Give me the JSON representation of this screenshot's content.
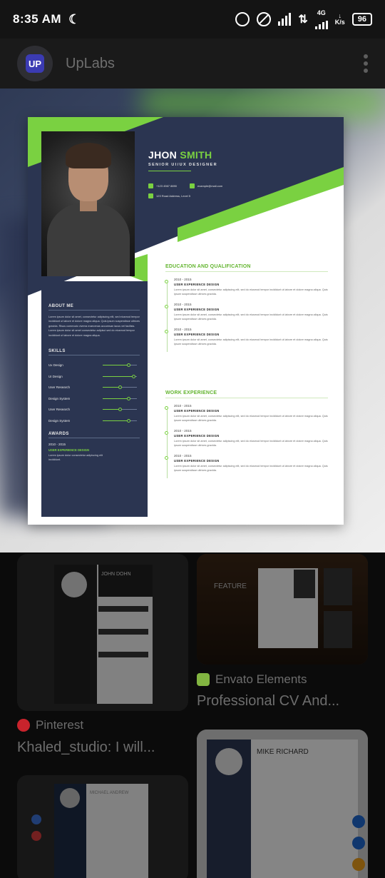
{
  "status_bar": {
    "time": "8:35 AM",
    "network": "4G",
    "speed_unit": "K/s",
    "battery": "96",
    "icons": [
      "moon-icon",
      "alarm-icon",
      "do-not-disturb-icon",
      "signal-icon",
      "data-arrows-icon",
      "signal-4g-icon",
      "battery-icon"
    ]
  },
  "app_bar": {
    "logo_text": "UP",
    "title": "UpLabs"
  },
  "resume": {
    "first_name": "JHON",
    "last_name": "SMITH",
    "role": "SENIOR UI/UX DESIGNER",
    "phone": "+123 4567 8890",
    "email": "example@mail.com",
    "address": "123 Road Address, Level 5",
    "about_title": "ABOUT ME",
    "about_text": "Lorem ipsum dolor sit amet, consectetur adipiscing elit, sed eiusmod tempor incididunt ut labore et dolore magna aliqua. Quis ipsum suspendisse ultrices gravida. Risus commodo viverra maecenas accumsan lacus vel facilisis. Lorem ipsum dolor sit amet consectetur adipisci sed do eiusmod tempor incididunt ut labore et dolore magna aliqua.",
    "skills_title": "SKILLS",
    "skills": [
      {
        "label": "Ux Design",
        "level": 0.75
      },
      {
        "label": "UI Design",
        "level": 0.9
      },
      {
        "label": "User Research",
        "level": 0.5
      },
      {
        "label": "Design System",
        "level": 0.75
      },
      {
        "label": "User Research",
        "level": 0.5
      },
      {
        "label": "Design System",
        "level": 0.75
      }
    ],
    "awards_title": "AWARDS",
    "award_years": "2010 - 2015",
    "award_name": "USER EXPERIENCE DESIGN",
    "award_text": "Lorem ipsum dolor consectetur adipiscing elit incididunt.",
    "education_title": "EDUCATION AND QUALIFICATION",
    "education": [
      {
        "years": "2010 - 2015",
        "title": "USER EXPERIENCE DESIGN",
        "desc": "Lorem ipsum dolor sit amet, consectetur adipiscing elit, sed do eiusmod tempor incididunt ut labore et dolore magna aliqua. Quis ipsum suspendisse ultrices gravida."
      },
      {
        "years": "2010 - 2015",
        "title": "USER EXPERIENCE DESIGN",
        "desc": "Lorem ipsum dolor sit amet, consectetur adipiscing elit, sed do eiusmod tempor incididunt ut labore et dolore magna aliqua. Quis ipsum suspendisse ultrices gravida."
      },
      {
        "years": "2010 - 2015",
        "title": "USER EXPERIENCE DESIGN",
        "desc": "Lorem ipsum dolor sit amet, consectetur adipiscing elit, sed do eiusmod tempor incididunt ut labore et dolore magna aliqua. Quis ipsum suspendisse ultrices gravida."
      }
    ],
    "work_title": "WORK EXPERIENCE",
    "work": [
      {
        "years": "2010 - 2015",
        "title": "USER EXPERIENCE DESIGN",
        "desc": "Lorem ipsum dolor sit amet, consectetur adipiscing elit, sed do eiusmod tempor incididunt ut labore et dolore magna aliqua. Quis ipsum suspendisse ultrices gravida."
      },
      {
        "years": "2010 - 2015",
        "title": "USER EXPERIENCE DESIGN",
        "desc": "Lorem ipsum dolor sit amet, consectetur adipiscing elit, sed do eiusmod tempor incididunt ut labore et dolore magna aliqua. Quis ipsum suspendisse ultrices gravida."
      },
      {
        "years": "2010 - 2015",
        "title": "USER EXPERIENCE DESIGN",
        "desc": "Lorem ipsum dolor sit amet, consectetur adipiscing elit, sed do eiusmod tempor incididunt ut labore et dolore magna aliqua. Quis ipsum suspendisse ultrices gravida."
      }
    ]
  },
  "results": [
    {
      "source": "Pinterest",
      "caption": "Khaled_studio: I will...",
      "thumb_title": "JOHN DOHN"
    },
    {
      "source": "Envato Elements",
      "caption": "Professional CV And...",
      "thumb_title": "FEATURE"
    },
    {
      "thumb_title": "MICHAEL ANDREW"
    },
    {
      "thumb_title": "MIKE RICHARD"
    }
  ],
  "colors": {
    "accent_green": "#7ad141",
    "navy": "#2b3551",
    "pinterest_red": "#c8232c",
    "envato_green": "#82b541"
  }
}
